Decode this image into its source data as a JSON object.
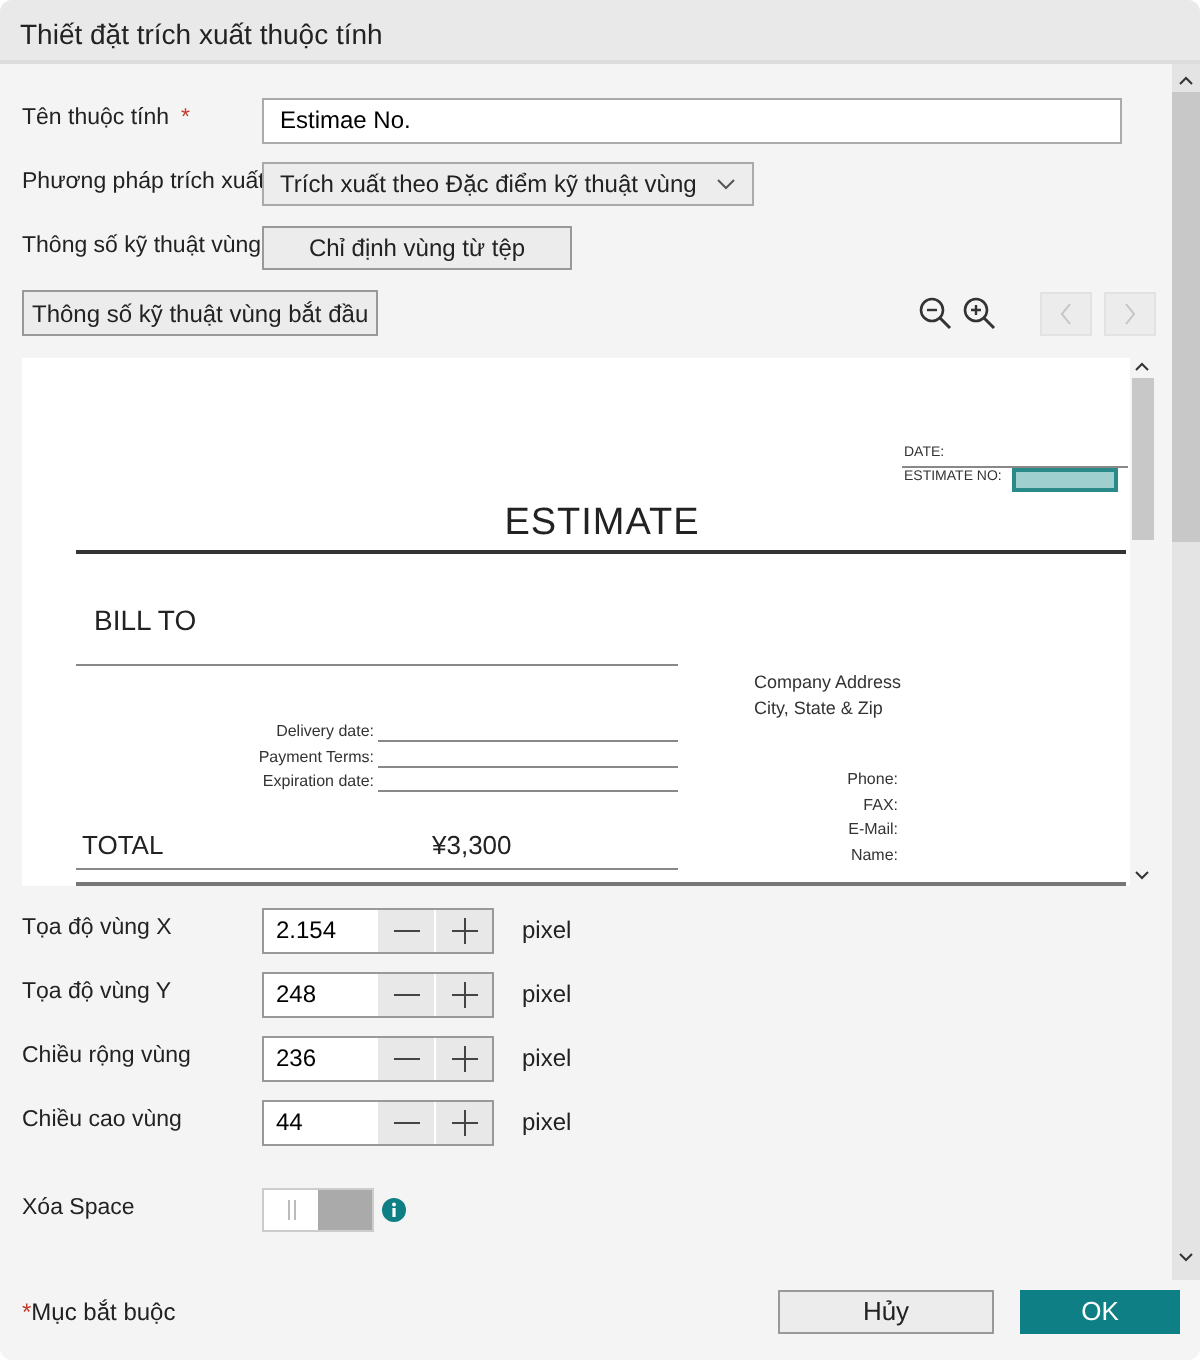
{
  "window": {
    "title": "Thiết đặt trích xuất thuộc tính"
  },
  "fields": [
    {
      "kind": "text",
      "label": "Tên thuộc tính",
      "required_mark": "*",
      "value": "Estimae No."
    },
    {
      "kind": "select",
      "label": "Phương pháp trích xuất",
      "value": "Trích xuất theo Đặc điểm kỹ thuật vùng"
    },
    {
      "kind": "button",
      "label": "Thông số kỹ thuật vùng",
      "button": "Chỉ định vùng từ tệp"
    }
  ],
  "start_button": "Thông số kỹ thuật vùng bắt đầu",
  "pager": [
    {
      "kind": "prev",
      "disabled": true
    },
    {
      "kind": "next",
      "disabled": true
    }
  ],
  "document": {
    "date_label": "DATE:",
    "estimate_no_label": "ESTIMATE NO:",
    "title": "ESTIMATE",
    "bill_to": "BILL TO",
    "terms": [
      "Delivery date:",
      "Payment Terms:",
      "Expiration date:"
    ],
    "total_label": "TOTAL",
    "total_value": "¥3,300",
    "company": [
      "Company Address",
      "City, State & Zip"
    ],
    "contacts": [
      "Phone:",
      "FAX:",
      "E-Mail:",
      "Name:"
    ]
  },
  "steppers": [
    {
      "label": "Tọa độ vùng X",
      "value": "2.154",
      "unit": "pixel"
    },
    {
      "label": "Tọa độ vùng Y",
      "value": "248",
      "unit": "pixel"
    },
    {
      "label": "Chiều rộng vùng",
      "value": "236",
      "unit": "pixel"
    },
    {
      "label": "Chiều cao vùng",
      "value": "44",
      "unit": "pixel"
    }
  ],
  "toggle": {
    "label": "Xóa Space",
    "on": false
  },
  "footer": {
    "mark": "*",
    "note": "Mục bắt buộc",
    "buttons": [
      {
        "label": "Hủy",
        "kind": "secondary"
      },
      {
        "label": "OK",
        "kind": "primary"
      }
    ]
  }
}
